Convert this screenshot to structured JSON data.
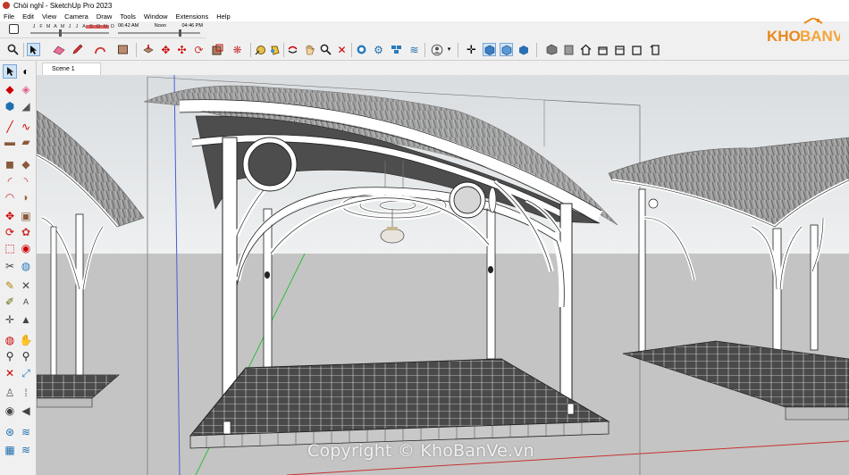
{
  "window": {
    "title": "Chòi nghỉ - SketchUp Pro 2023"
  },
  "menu": [
    "File",
    "Edit",
    "View",
    "Camera",
    "Draw",
    "Tools",
    "Window",
    "Extensions",
    "Help"
  ],
  "shadow": {
    "months": [
      "J",
      "F",
      "M",
      "A",
      "M",
      "J",
      "J",
      "A",
      "S",
      "O",
      "N",
      "D"
    ],
    "time_start": "06:42 AM",
    "time_noon": "Noon",
    "time_end": "04:46 PM"
  },
  "scene": {
    "tab_label": "Scene 1"
  },
  "logo": {
    "text": "KHOBANVE",
    "colors": {
      "kho": "#e8891c",
      "banve": "#f4a43a"
    }
  },
  "watermark": "Copyright © KhoBanVe.vn",
  "toolbar_icons": [
    "search-icon",
    "select-icon",
    "eraser-icon",
    "pencil-icon",
    "shape-icon",
    "paint-icon",
    "push-pull-icon",
    "move-icon",
    "rotate-icon",
    "scale-icon",
    "follow-me-icon",
    "offset-icon",
    "tape-icon",
    "protractor-icon",
    "text-icon",
    "dimension-icon",
    "section-icon",
    "axes-icon",
    "component-icon",
    "group-icon",
    "materials-icon",
    "styles-icon",
    "user-icon",
    "orbit-icon",
    "iso-view-icon",
    "top-view-icon",
    "front-view-icon",
    "right-view-icon",
    "back-view-icon",
    "left-view-icon",
    "xray-icon",
    "wireframe-icon",
    "hidden-line-icon",
    "shaded-icon",
    "textured-icon",
    "monochrome-icon"
  ],
  "palette_icons": [
    "select-icon",
    "orbit-icon",
    "paint-bucket-icon",
    "eraser-icon",
    "component-icon",
    "tape-icon",
    "line-icon",
    "freehand-icon",
    "rectangle-icon",
    "rotated-rect-icon",
    "circle-icon",
    "polygon-icon",
    "arc-icon",
    "two-point-arc-icon",
    "pie-icon",
    "three-point-arc-icon",
    "push-pull-icon",
    "follow-me-icon",
    "move-icon",
    "rotate-icon",
    "scale-icon",
    "offset-icon",
    "tape-measure-icon",
    "dimension-icon",
    "protractor-icon",
    "text-icon",
    "axes-icon",
    "3d-text-icon",
    "orbit-tool-icon",
    "pan-icon",
    "zoom-icon",
    "zoom-window-icon",
    "zoom-extents-icon",
    "previous-icon",
    "position-camera-icon",
    "walk-icon",
    "look-around-icon",
    "section-plane-icon",
    "display-section-icon",
    "sandbox-icon"
  ]
}
